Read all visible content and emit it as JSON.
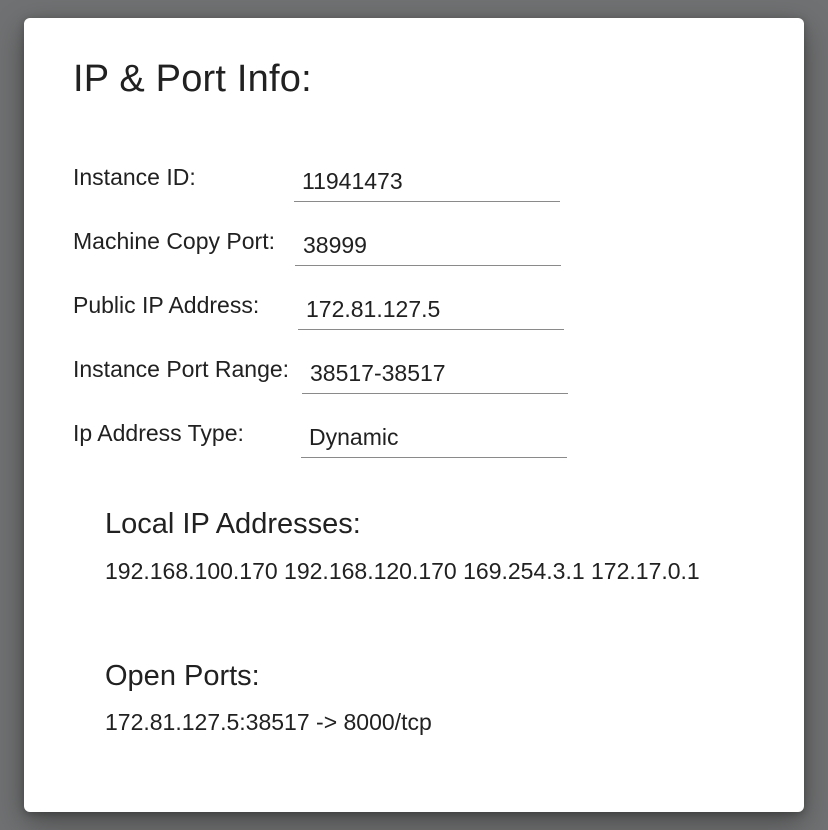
{
  "dialog": {
    "title": "IP & Port Info:"
  },
  "fields": [
    {
      "label": "Instance ID:",
      "value": "11941473"
    },
    {
      "label": "Machine Copy Port:",
      "value": "38999"
    },
    {
      "label": "Public IP Address:",
      "value": "172.81.127.5"
    },
    {
      "label": "Instance Port Range:",
      "value": "38517-38517"
    },
    {
      "label": "Ip Address Type:",
      "value": "Dynamic"
    }
  ],
  "local_ips": {
    "heading": "Local IP Addresses:",
    "text": "192.168.100.170 192.168.120.170 169.254.3.1 172.17.0.1"
  },
  "open_ports": {
    "heading": "Open Ports:",
    "text": "172.81.127.5:38517 -> 8000/tcp"
  }
}
